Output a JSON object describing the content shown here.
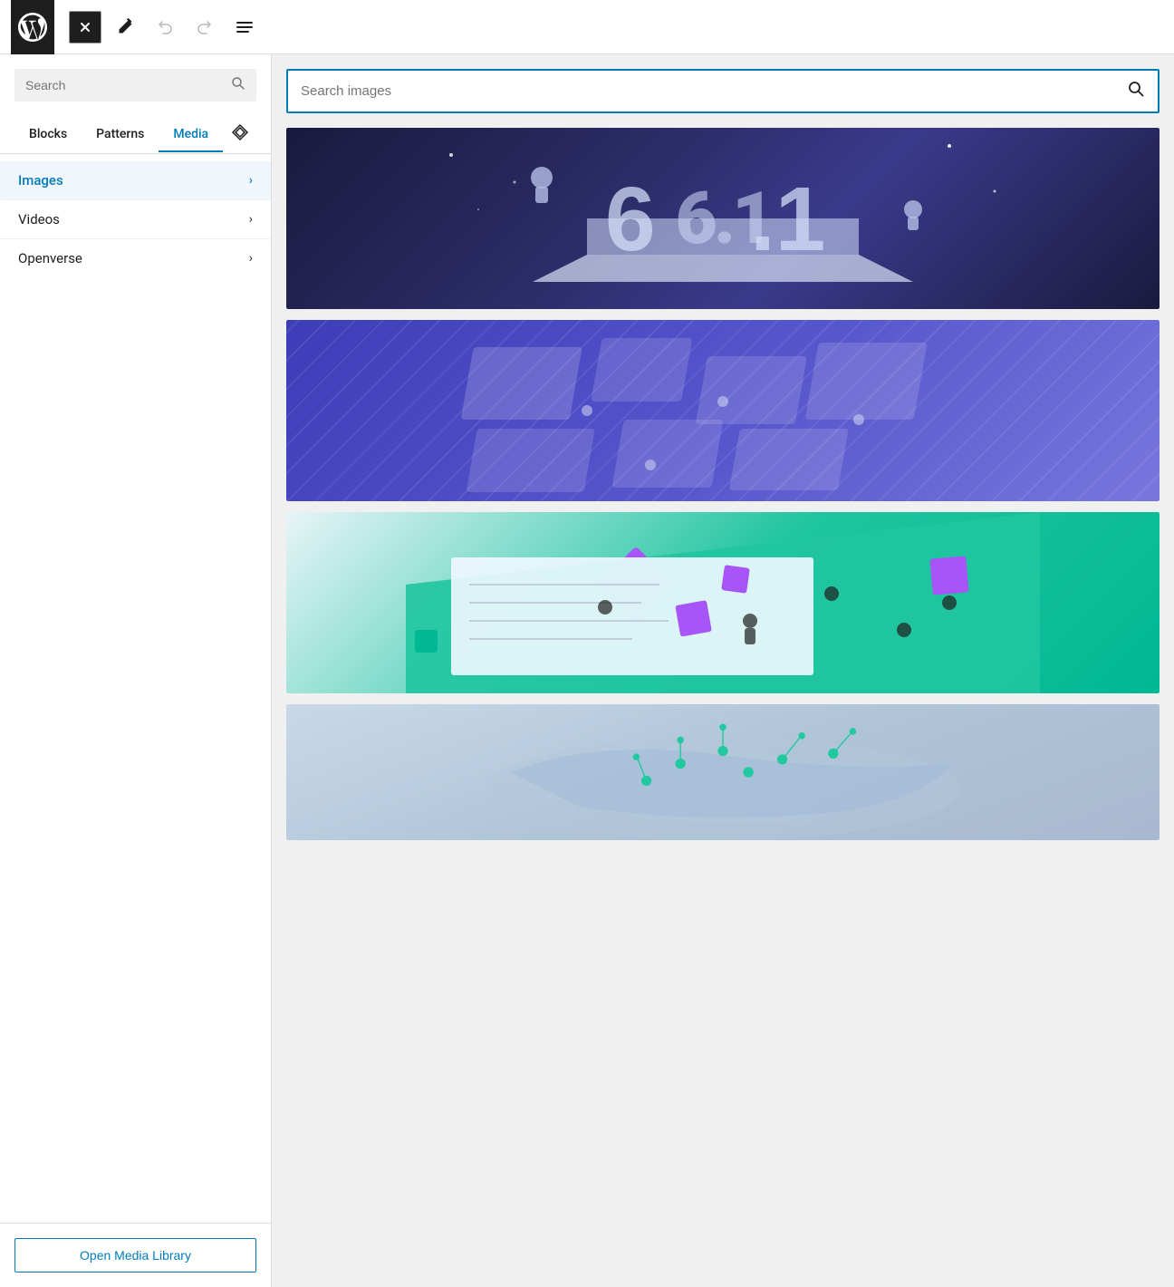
{
  "toolbar": {
    "close_label": "×",
    "undo_label": "Undo",
    "redo_label": "Redo",
    "menu_label": "Menu"
  },
  "left_panel": {
    "search": {
      "placeholder": "Search",
      "value": ""
    },
    "tabs": [
      {
        "id": "blocks",
        "label": "Blocks"
      },
      {
        "id": "patterns",
        "label": "Patterns"
      },
      {
        "id": "media",
        "label": "Media"
      }
    ],
    "active_tab": "media",
    "media_items": [
      {
        "id": "images",
        "label": "Images",
        "active": true
      },
      {
        "id": "videos",
        "label": "Videos",
        "active": false
      },
      {
        "id": "openverse",
        "label": "Openverse",
        "active": false
      }
    ],
    "open_media_library_label": "Open Media Library"
  },
  "right_panel": {
    "search": {
      "placeholder": "Search images",
      "value": ""
    },
    "images": [
      {
        "id": "img-1",
        "alt": "WordPress 6.1 illustration with astronauts"
      },
      {
        "id": "img-2",
        "alt": "Purple isometric layout illustration"
      },
      {
        "id": "img-3",
        "alt": "Teal and purple team collaboration illustration"
      },
      {
        "id": "img-4",
        "alt": "World map with location pins illustration"
      }
    ]
  }
}
